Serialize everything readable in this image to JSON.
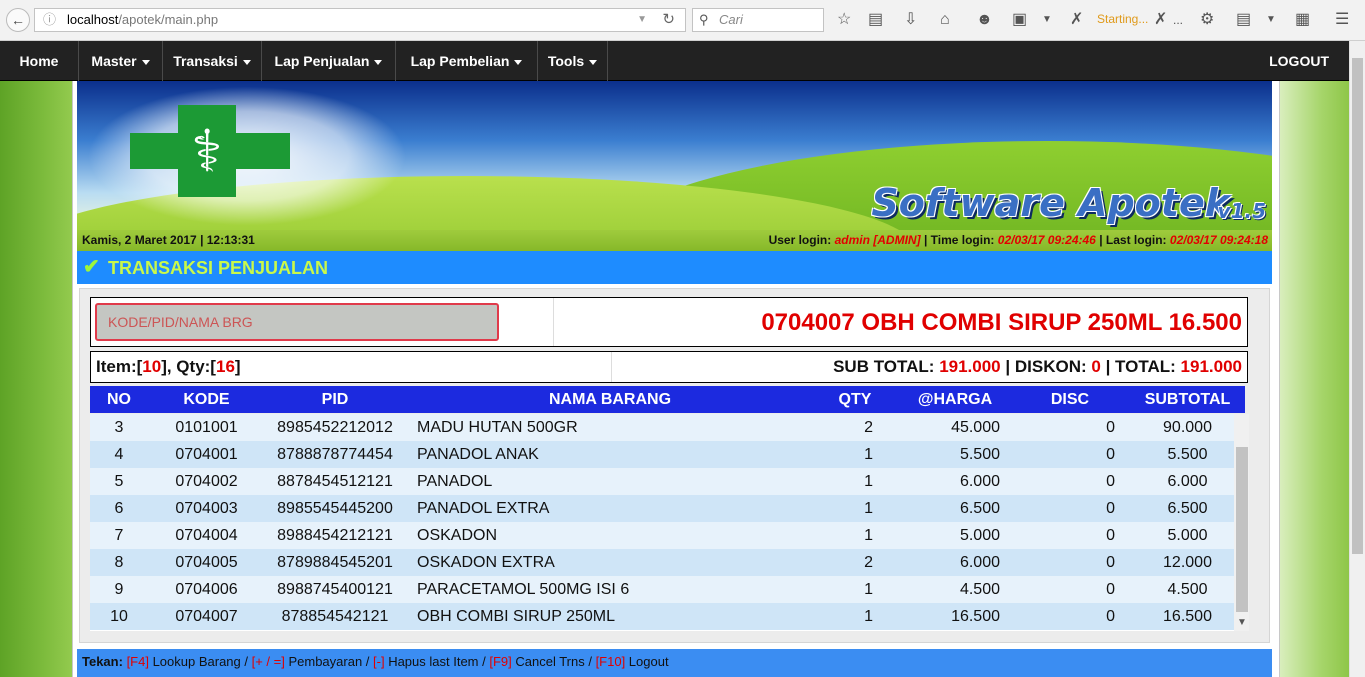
{
  "browser": {
    "url_host": "localhost",
    "url_path": "/apotek/main.php",
    "search_placeholder": "Cari",
    "status_text": "Starting...",
    "overflow_label": "..."
  },
  "nav": {
    "home": "Home",
    "master": "Master",
    "transaksi": "Transaksi",
    "lap_penjualan": "Lap Penjualan",
    "lap_pembelian": "Lap Pembelian",
    "tools": "Tools",
    "logout": "LOGOUT"
  },
  "banner": {
    "brand": "Software Apotek",
    "version": "v1.5"
  },
  "status": {
    "date_time": "Kamis, 2 Maret 2017 | 12:13:31",
    "user_login_label": "User login:",
    "user_login": "admin [ADMIN]",
    "time_login_label": "| Time login:",
    "time_login": "02/03/17 09:24:46",
    "last_login_label": "| Last login:",
    "last_login": "02/03/17 09:24:18"
  },
  "page": {
    "title": "TRANSAKSI PENJUALAN"
  },
  "input": {
    "placeholder": "KODE/PID/NAMA BRG"
  },
  "current_item": "0704007 OBH COMBI SIRUP 250ML 16.500",
  "summary": {
    "item_label": "Item:[",
    "item_count": "10",
    "qty_label": "], Qty:[",
    "qty_count": "16",
    "close_bracket": "]",
    "subtotal_label": "SUB TOTAL:",
    "subtotal": "191.000",
    "diskon_label": "| DISKON:",
    "diskon": "0",
    "total_label": "| TOTAL:",
    "total": "191.000"
  },
  "table": {
    "headers": {
      "no": "NO",
      "kode": "KODE",
      "pid": "PID",
      "nama": "NAMA BARANG",
      "qty": "QTY",
      "harga": "@HARGA",
      "disc": "DISC",
      "subtotal": "SUBTOTAL"
    },
    "rows": [
      {
        "no": "3",
        "kode": "0101001",
        "pid": "8985452212012",
        "nama": "MADU HUTAN 500GR",
        "qty": "2",
        "harga": "45.000",
        "disc": "0",
        "subtotal": "90.000"
      },
      {
        "no": "4",
        "kode": "0704001",
        "pid": "8788878774454",
        "nama": "PANADOL ANAK",
        "qty": "1",
        "harga": "5.500",
        "disc": "0",
        "subtotal": "5.500"
      },
      {
        "no": "5",
        "kode": "0704002",
        "pid": "8878454512121",
        "nama": "PANADOL",
        "qty": "1",
        "harga": "6.000",
        "disc": "0",
        "subtotal": "6.000"
      },
      {
        "no": "6",
        "kode": "0704003",
        "pid": "8985545445200",
        "nama": "PANADOL EXTRA",
        "qty": "1",
        "harga": "6.500",
        "disc": "0",
        "subtotal": "6.500"
      },
      {
        "no": "7",
        "kode": "0704004",
        "pid": "8988454212121",
        "nama": "OSKADON",
        "qty": "1",
        "harga": "5.000",
        "disc": "0",
        "subtotal": "5.000"
      },
      {
        "no": "8",
        "kode": "0704005",
        "pid": "8789884545201",
        "nama": "OSKADON EXTRA",
        "qty": "2",
        "harga": "6.000",
        "disc": "0",
        "subtotal": "12.000"
      },
      {
        "no": "9",
        "kode": "0704006",
        "pid": "8988745400121",
        "nama": "PARACETAMOL 500MG ISI 6",
        "qty": "1",
        "harga": "4.500",
        "disc": "0",
        "subtotal": "4.500"
      },
      {
        "no": "10",
        "kode": "0704007",
        "pid": "878854542121",
        "nama": "OBH COMBI SIRUP 250ML",
        "qty": "1",
        "harga": "16.500",
        "disc": "0",
        "subtotal": "16.500"
      }
    ]
  },
  "footer": {
    "prefix": "Tekan:",
    "k1": "[F4]",
    "t1": " Lookup Barang / ",
    "k2": "[+ / =]",
    "t2": " Pembayaran / ",
    "k3": "[-]",
    "t3": " Hapus last Item / ",
    "k4": "[F9]",
    "t4": " Cancel Trns / ",
    "k5": "[F10]",
    "t5": " Logout"
  },
  "colors": {
    "nav_bg": "#222222",
    "title_bar": "#1e8cff",
    "title_text": "#c9f84a",
    "table_header": "#1c2adf",
    "row_even": "#cfe5f7",
    "row_odd": "#e7f2fb",
    "accent_red": "#e00000",
    "footer_bg": "#3b8df2"
  }
}
